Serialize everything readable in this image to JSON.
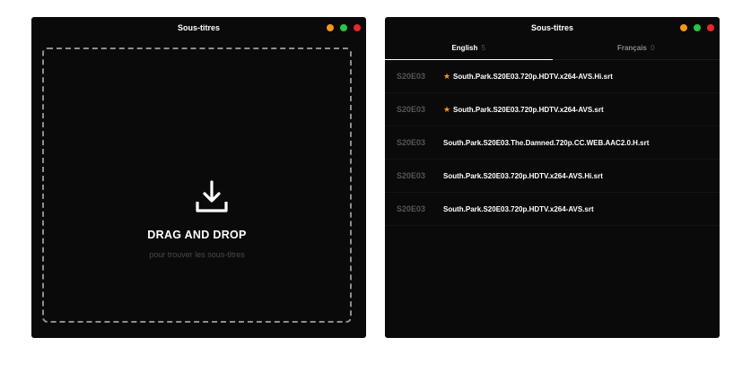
{
  "left_window": {
    "title": "Sous-titres",
    "drop_title": "DRAG AND DROP",
    "drop_subtitle": "pour trouver les sous-titres"
  },
  "right_window": {
    "title": "Sous-titres",
    "tabs": [
      {
        "label": "English",
        "count": "5",
        "active": true
      },
      {
        "label": "Français",
        "count": "0",
        "active": false
      }
    ],
    "subtitles": [
      {
        "episode": "S20E03",
        "starred": true,
        "star": "★",
        "name": "South.Park.S20E03.720p.HDTV.x264-AVS.Hi.srt"
      },
      {
        "episode": "S20E03",
        "starred": true,
        "star": "★",
        "name": "South.Park.S20E03.720p.HDTV.x264-AVS.srt"
      },
      {
        "episode": "S20E03",
        "starred": false,
        "star": "",
        "name": "South.Park.S20E03.The.Damned.720p.CC.WEB.AAC2.0.H.srt"
      },
      {
        "episode": "S20E03",
        "starred": false,
        "star": "",
        "name": "South.Park.S20E03.720p.HDTV.x264-AVS.Hi.srt"
      },
      {
        "episode": "S20E03",
        "starred": false,
        "star": "",
        "name": "South.Park.S20E03.720p.HDTV.x264-AVS.srt"
      }
    ]
  },
  "colors": {
    "window_bg": "#0a0a0a",
    "accent_star": "#f39a1d",
    "dot_orange": "#f5961e",
    "dot_green": "#2bc541",
    "dot_red": "#e8262c"
  },
  "icons": {
    "drop": "download-tray-icon",
    "star": "star-icon"
  }
}
